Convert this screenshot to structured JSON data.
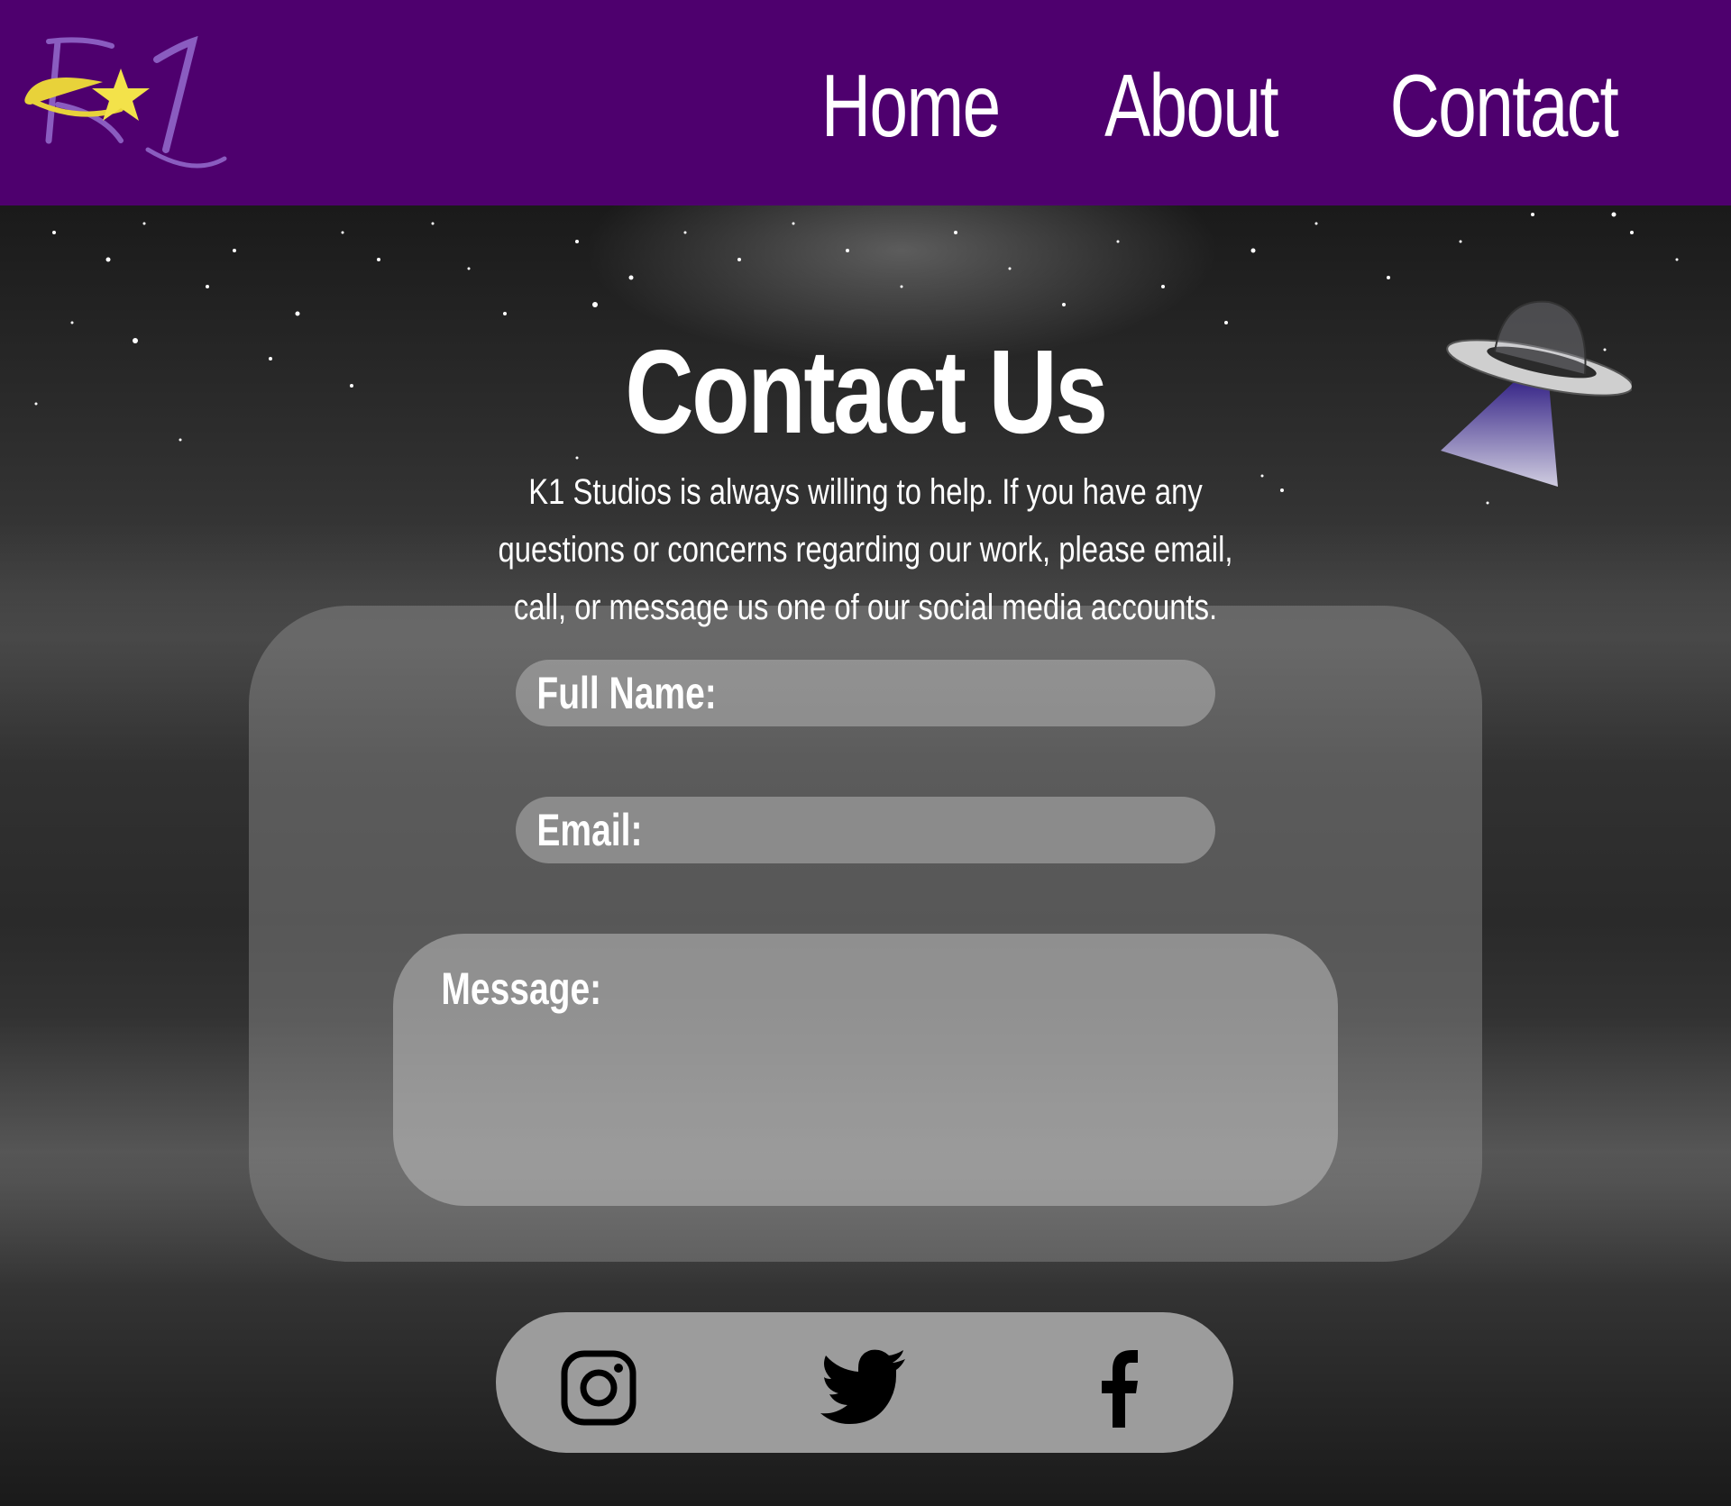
{
  "header": {
    "logo_alt": "K1 Studios",
    "nav": [
      {
        "label": "Home"
      },
      {
        "label": "About"
      },
      {
        "label": "Contact"
      }
    ],
    "background_color": "#4e006e"
  },
  "main": {
    "title": "Contact Us",
    "intro": "K1 Studios is always willing to help. If you have any questions or concerns regarding our work, please email, call, or message us one of our social media accounts.",
    "decoration": "ufo-icon"
  },
  "form": {
    "full_name_label": "Full Name:",
    "email_label": "Email:",
    "message_label": "Message:"
  },
  "social": {
    "icons": [
      "instagram-icon",
      "twitter-icon",
      "facebook-icon"
    ]
  }
}
